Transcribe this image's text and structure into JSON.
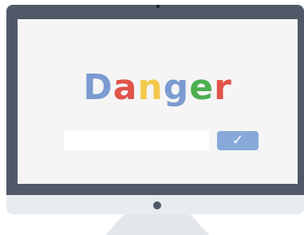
{
  "logo": {
    "letters": [
      {
        "char": "D",
        "color": "#7b9bd1"
      },
      {
        "char": "a",
        "color": "#e0544a"
      },
      {
        "char": "n",
        "color": "#f2c94c"
      },
      {
        "char": "g",
        "color": "#7b9bd1"
      },
      {
        "char": "e",
        "color": "#4caf50"
      },
      {
        "char": "r",
        "color": "#e0544a"
      }
    ]
  },
  "search": {
    "value": "",
    "placeholder": ""
  },
  "submit_button": {
    "label": "✓"
  },
  "colors": {
    "bezel": "#515968",
    "screen": "#f5f5f5",
    "chin": "#e8ebf0",
    "button": "#86a9da"
  }
}
